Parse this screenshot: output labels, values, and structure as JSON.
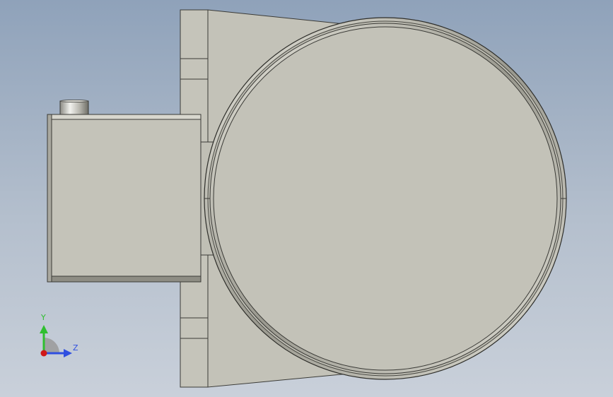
{
  "viewport": {
    "background_top": "#8fa2ba",
    "background_bottom": "#c9d0da"
  },
  "model": {
    "body_color": "#c3c2b8",
    "edge_color": "#3a3a36",
    "shade_color": "#8e8d84"
  },
  "triad": {
    "y_label": "Y",
    "z_label": "Z",
    "y_color": "#2fbf2f",
    "z_color": "#2f4fe0",
    "x_color": "#d01818"
  }
}
